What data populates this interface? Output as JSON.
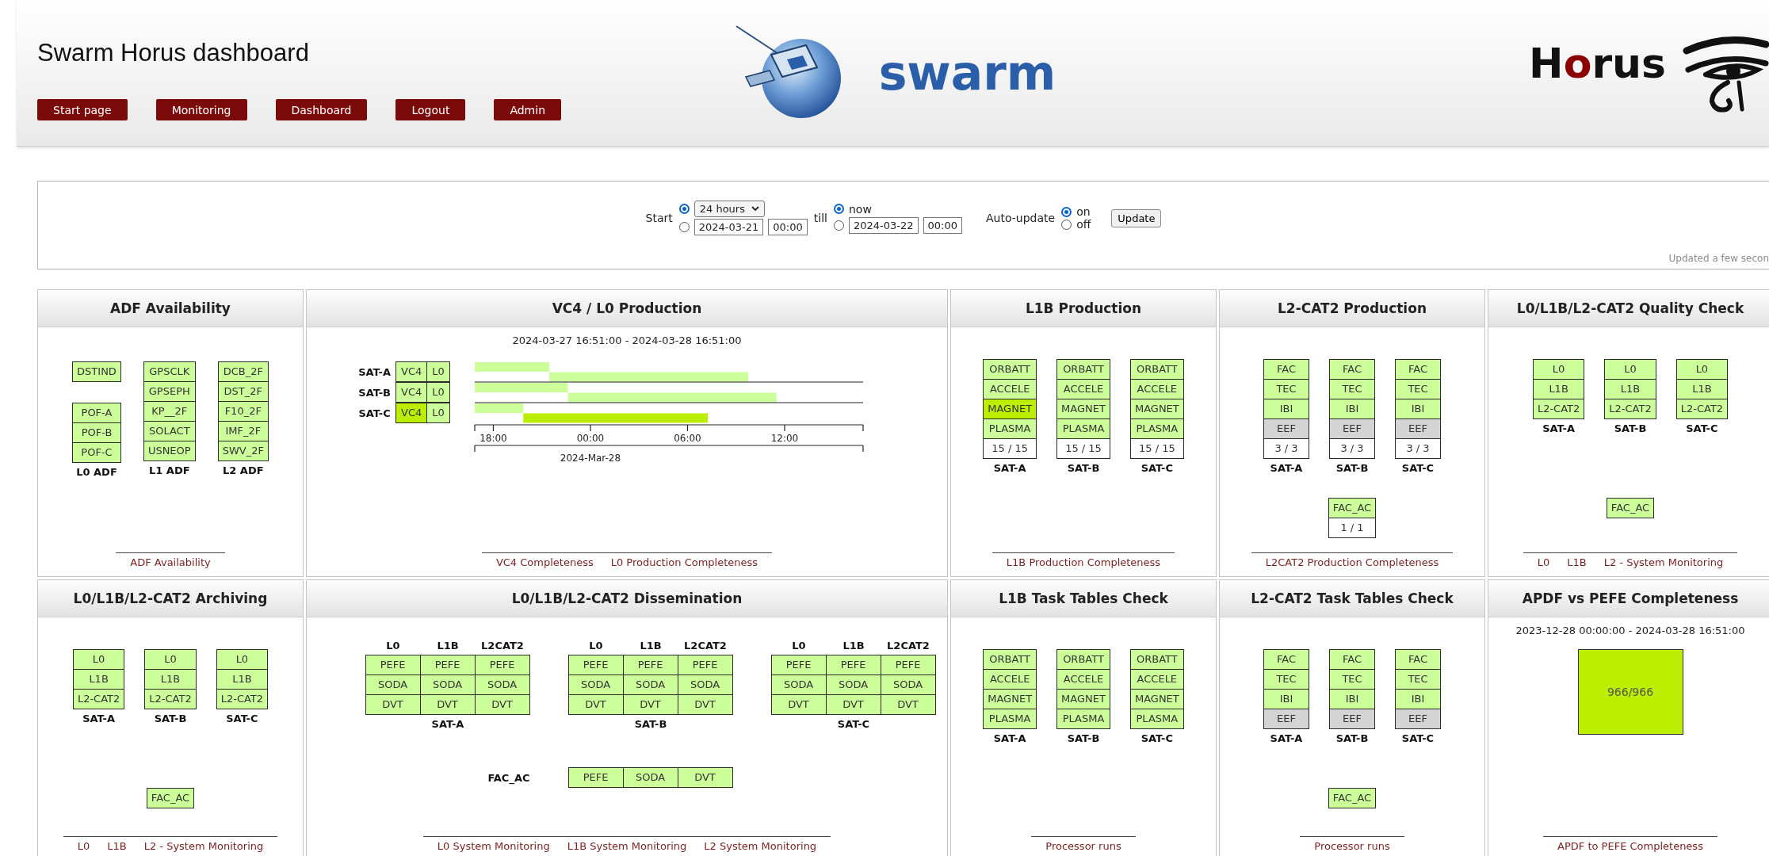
{
  "header": {
    "title": "Swarm Horus dashboard",
    "nav": [
      "Start page",
      "Monitoring",
      "Dashboard",
      "Logout",
      "Admin"
    ],
    "logo_text": "swarm",
    "brand": [
      {
        "text": "H",
        "accent": false
      },
      {
        "text": "o",
        "accent": true
      },
      {
        "text": "rus",
        "accent": false
      }
    ]
  },
  "controls": {
    "start_label": "Start",
    "start_options": [
      {
        "kind": "select",
        "value": "24 hours",
        "selected": true
      },
      {
        "kind": "datetime",
        "date": "2024-03-21",
        "time": "00:00",
        "selected": false
      }
    ],
    "till_label": "till",
    "end_options": [
      {
        "kind": "label",
        "label": "now",
        "selected": true
      },
      {
        "kind": "datetime",
        "date": "2024-03-22",
        "time": "00:00",
        "selected": false
      }
    ],
    "auto_label": "Auto-update",
    "auto_options": [
      {
        "label": "on",
        "selected": true
      },
      {
        "label": "off",
        "selected": false
      }
    ],
    "button": "Update",
    "status": "Updated a few secon"
  },
  "panels": [
    {
      "title": "ADF Availability",
      "kind": "adf",
      "columns": [
        {
          "label": "L0 ADF",
          "groups": [
            [
              {
                "text": "DSTIND",
                "color": "#ccff99"
              }
            ],
            [
              {
                "text": "POF-A",
                "color": "#ccff99"
              },
              {
                "text": "POF-B",
                "color": "#ccff99"
              },
              {
                "text": "POF-C",
                "color": "#ccff99"
              }
            ]
          ]
        },
        {
          "label": "L1 ADF",
          "groups": [
            [
              {
                "text": "GPSCLK",
                "color": "#ccff99"
              },
              {
                "text": "GPSEPH",
                "color": "#ccff99"
              },
              {
                "text": "KP__2F",
                "color": "#ccff99"
              },
              {
                "text": "SOLACT",
                "color": "#ccff99"
              },
              {
                "text": "USNEOP",
                "color": "#ccff99"
              }
            ]
          ]
        },
        {
          "label": "L2 ADF",
          "groups": [
            [
              {
                "text": "DCB_2F",
                "color": "#ccff99"
              },
              {
                "text": "DST_2F",
                "color": "#ccff99"
              },
              {
                "text": "F10_2F",
                "color": "#ccff99"
              },
              {
                "text": "IMF_2F",
                "color": "#ccff99"
              },
              {
                "text": "SWV_2F",
                "color": "#ccff99"
              }
            ]
          ]
        }
      ],
      "footer": [
        "ADF Availability"
      ]
    },
    {
      "title": "VC4 / L0 Production",
      "kind": "gantt",
      "range": "2024-03-27 16:51:00 - 2024-03-28 16:51:00",
      "axis": {
        "ticks": [
          "18:00",
          "00:00",
          "06:00",
          "12:00"
        ],
        "date_label": "2024-Mar-28"
      },
      "rows": [
        {
          "label": "SAT-A",
          "cells": [
            {
              "text": "VC4",
              "color": "#ccff99"
            },
            {
              "text": "L0",
              "color": "#ccff99"
            }
          ],
          "bars": [
            {
              "color": "#ccff99"
            },
            {
              "color": "#ccff99"
            }
          ]
        },
        {
          "label": "SAT-B",
          "cells": [
            {
              "text": "VC4",
              "color": "#ccff99"
            },
            {
              "text": "L0",
              "color": "#ccff99"
            }
          ],
          "bars": [
            {
              "color": "#ccff99"
            },
            {
              "color": "#ccff99"
            }
          ]
        },
        {
          "label": "SAT-C",
          "cells": [
            {
              "text": "VC4",
              "color": "#bbee00"
            },
            {
              "text": "L0",
              "color": "#ccff99"
            }
          ],
          "bars": [
            {
              "color": "#ccff99"
            },
            {
              "color": "#bbee00"
            }
          ]
        }
      ],
      "footer": [
        "VC4 Completeness",
        "L0 Production Completeness"
      ]
    },
    {
      "title": "L1B Production",
      "kind": "stacks",
      "stacks": [
        {
          "label": "SAT-A",
          "cells": [
            {
              "text": "ORBATT",
              "color": "#ccff99"
            },
            {
              "text": "ACCELE",
              "color": "#ccff99"
            },
            {
              "text": "MAGNET",
              "color": "#bbee00"
            },
            {
              "text": "PLASMA",
              "color": "#ccff99"
            },
            {
              "text": "15 / 15",
              "color": "#ffffff"
            }
          ]
        },
        {
          "label": "SAT-B",
          "cells": [
            {
              "text": "ORBATT",
              "color": "#ccff99"
            },
            {
              "text": "ACCELE",
              "color": "#ccff99"
            },
            {
              "text": "MAGNET",
              "color": "#ccff99"
            },
            {
              "text": "PLASMA",
              "color": "#ccff99"
            },
            {
              "text": "15 / 15",
              "color": "#ffffff"
            }
          ]
        },
        {
          "label": "SAT-C",
          "cells": [
            {
              "text": "ORBATT",
              "color": "#ccff99"
            },
            {
              "text": "ACCELE",
              "color": "#ccff99"
            },
            {
              "text": "MAGNET",
              "color": "#ccff99"
            },
            {
              "text": "PLASMA",
              "color": "#ccff99"
            },
            {
              "text": "15 / 15",
              "color": "#ffffff"
            }
          ]
        }
      ],
      "footer": [
        "L1B Production Completeness"
      ]
    },
    {
      "title": "L2-CAT2 Production",
      "kind": "stacks",
      "stacks": [
        {
          "label": "SAT-A",
          "cells": [
            {
              "text": "FAC",
              "color": "#ccff99"
            },
            {
              "text": "TEC",
              "color": "#ccff99"
            },
            {
              "text": "IBI",
              "color": "#ccff99"
            },
            {
              "text": "EEF",
              "color": "#d4d4d4"
            },
            {
              "text": "3 / 3",
              "color": "#ffffff"
            }
          ]
        },
        {
          "label": "SAT-B",
          "cells": [
            {
              "text": "FAC",
              "color": "#ccff99"
            },
            {
              "text": "TEC",
              "color": "#ccff99"
            },
            {
              "text": "IBI",
              "color": "#ccff99"
            },
            {
              "text": "EEF",
              "color": "#d4d4d4"
            },
            {
              "text": "3 / 3",
              "color": "#ffffff"
            }
          ]
        },
        {
          "label": "SAT-C",
          "cells": [
            {
              "text": "FAC",
              "color": "#ccff99"
            },
            {
              "text": "TEC",
              "color": "#ccff99"
            },
            {
              "text": "IBI",
              "color": "#ccff99"
            },
            {
              "text": "EEF",
              "color": "#d4d4d4"
            },
            {
              "text": "3 / 3",
              "color": "#ffffff"
            }
          ]
        }
      ],
      "extra": [
        {
          "text": "FAC_AC",
          "color": "#ccff99"
        },
        {
          "text": "1 / 1",
          "color": "#ffffff"
        }
      ],
      "footer": [
        "L2CAT2 Production Completeness"
      ]
    },
    {
      "title": "L0/L1B/L2-CAT2 Quality Check",
      "kind": "stacks",
      "stacks": [
        {
          "label": "SAT-A",
          "cells": [
            {
              "text": "L0",
              "color": "#ccff99"
            },
            {
              "text": "L1B",
              "color": "#ccff99"
            },
            {
              "text": "L2-CAT2",
              "color": "#ccff99"
            }
          ]
        },
        {
          "label": "SAT-B",
          "cells": [
            {
              "text": "L0",
              "color": "#ccff99"
            },
            {
              "text": "L1B",
              "color": "#ccff99"
            },
            {
              "text": "L2-CAT2",
              "color": "#ccff99"
            }
          ]
        },
        {
          "label": "SAT-C",
          "cells": [
            {
              "text": "L0",
              "color": "#ccff99"
            },
            {
              "text": "L1B",
              "color": "#ccff99"
            },
            {
              "text": "L2-CAT2",
              "color": "#ccff99"
            }
          ]
        }
      ],
      "extra": [
        {
          "text": "FAC_AC",
          "color": "#ccff99"
        }
      ],
      "footer": [
        "L0",
        "L1B",
        "L2 - System Monitoring"
      ]
    },
    {
      "title": "L0/L1B/L2-CAT2 Archiving",
      "kind": "stacks",
      "stacks": [
        {
          "label": "SAT-A",
          "cells": [
            {
              "text": "L0",
              "color": "#ccff99"
            },
            {
              "text": "L1B",
              "color": "#ccff99"
            },
            {
              "text": "L2-CAT2",
              "color": "#ccff99"
            }
          ]
        },
        {
          "label": "SAT-B",
          "cells": [
            {
              "text": "L0",
              "color": "#ccff99"
            },
            {
              "text": "L1B",
              "color": "#ccff99"
            },
            {
              "text": "L2-CAT2",
              "color": "#ccff99"
            }
          ]
        },
        {
          "label": "SAT-C",
          "cells": [
            {
              "text": "L0",
              "color": "#ccff99"
            },
            {
              "text": "L1B",
              "color": "#ccff99"
            },
            {
              "text": "L2-CAT2",
              "color": "#ccff99"
            }
          ]
        }
      ],
      "extra": [
        {
          "text": "FAC_AC",
          "color": "#ccff99"
        }
      ],
      "footer": [
        "L0",
        "L1B",
        "L2 - System Monitoring"
      ]
    },
    {
      "title": "L0/L1B/L2-CAT2 Dissemination",
      "kind": "dissemination",
      "groups": [
        {
          "label": "SAT-A",
          "columns": [
            "L0",
            "L1B",
            "L2CAT2"
          ],
          "rows": [
            [
              {
                "text": "PEFE",
                "color": "#ccff99"
              },
              {
                "text": "PEFE",
                "color": "#ccff99"
              },
              {
                "text": "PEFE",
                "color": "#ccff99"
              }
            ],
            [
              {
                "text": "SODA",
                "color": "#ccff99"
              },
              {
                "text": "SODA",
                "color": "#ccff99"
              },
              {
                "text": "SODA",
                "color": "#ccff99"
              }
            ],
            [
              {
                "text": "DVT",
                "color": "#ccff99"
              },
              {
                "text": "DVT",
                "color": "#ccff99"
              },
              {
                "text": "DVT",
                "color": "#ccff99"
              }
            ]
          ]
        },
        {
          "label": "SAT-B",
          "columns": [
            "L0",
            "L1B",
            "L2CAT2"
          ],
          "rows": [
            [
              {
                "text": "PEFE",
                "color": "#ccff99"
              },
              {
                "text": "PEFE",
                "color": "#ccff99"
              },
              {
                "text": "PEFE",
                "color": "#ccff99"
              }
            ],
            [
              {
                "text": "SODA",
                "color": "#ccff99"
              },
              {
                "text": "SODA",
                "color": "#ccff99"
              },
              {
                "text": "SODA",
                "color": "#ccff99"
              }
            ],
            [
              {
                "text": "DVT",
                "color": "#ccff99"
              },
              {
                "text": "DVT",
                "color": "#ccff99"
              },
              {
                "text": "DVT",
                "color": "#ccff99"
              }
            ]
          ]
        },
        {
          "label": "SAT-C",
          "columns": [
            "L0",
            "L1B",
            "L2CAT2"
          ],
          "rows": [
            [
              {
                "text": "PEFE",
                "color": "#ccff99"
              },
              {
                "text": "PEFE",
                "color": "#ccff99"
              },
              {
                "text": "PEFE",
                "color": "#ccff99"
              }
            ],
            [
              {
                "text": "SODA",
                "color": "#ccff99"
              },
              {
                "text": "SODA",
                "color": "#ccff99"
              },
              {
                "text": "SODA",
                "color": "#ccff99"
              }
            ],
            [
              {
                "text": "DVT",
                "color": "#ccff99"
              },
              {
                "text": "DVT",
                "color": "#ccff99"
              },
              {
                "text": "DVT",
                "color": "#ccff99"
              }
            ]
          ]
        }
      ],
      "extra": {
        "label": "FAC_AC",
        "cells": [
          {
            "text": "PEFE",
            "color": "#ccff99"
          },
          {
            "text": "SODA",
            "color": "#ccff99"
          },
          {
            "text": "DVT",
            "color": "#ccff99"
          }
        ]
      },
      "footer": [
        "L0 System Monitoring",
        "L1B System Monitoring",
        "L2 System Monitoring"
      ]
    },
    {
      "title": "L1B Task Tables Check",
      "kind": "stacks",
      "stacks": [
        {
          "label": "SAT-A",
          "cells": [
            {
              "text": "ORBATT",
              "color": "#ccff99"
            },
            {
              "text": "ACCELE",
              "color": "#ccff99"
            },
            {
              "text": "MAGNET",
              "color": "#ccff99"
            },
            {
              "text": "PLASMA",
              "color": "#ccff99"
            }
          ]
        },
        {
          "label": "SAT-B",
          "cells": [
            {
              "text": "ORBATT",
              "color": "#ccff99"
            },
            {
              "text": "ACCELE",
              "color": "#ccff99"
            },
            {
              "text": "MAGNET",
              "color": "#ccff99"
            },
            {
              "text": "PLASMA",
              "color": "#ccff99"
            }
          ]
        },
        {
          "label": "SAT-C",
          "cells": [
            {
              "text": "ORBATT",
              "color": "#ccff99"
            },
            {
              "text": "ACCELE",
              "color": "#ccff99"
            },
            {
              "text": "MAGNET",
              "color": "#ccff99"
            },
            {
              "text": "PLASMA",
              "color": "#ccff99"
            }
          ]
        }
      ],
      "footer": [
        "Processor runs"
      ]
    },
    {
      "title": "L2-CAT2 Task Tables Check",
      "kind": "stacks",
      "stacks": [
        {
          "label": "SAT-A",
          "cells": [
            {
              "text": "FAC",
              "color": "#ccff99"
            },
            {
              "text": "TEC",
              "color": "#ccff99"
            },
            {
              "text": "IBI",
              "color": "#ccff99"
            },
            {
              "text": "EEF",
              "color": "#d4d4d4"
            }
          ]
        },
        {
          "label": "SAT-B",
          "cells": [
            {
              "text": "FAC",
              "color": "#ccff99"
            },
            {
              "text": "TEC",
              "color": "#ccff99"
            },
            {
              "text": "IBI",
              "color": "#ccff99"
            },
            {
              "text": "EEF",
              "color": "#d4d4d4"
            }
          ]
        },
        {
          "label": "SAT-C",
          "cells": [
            {
              "text": "FAC",
              "color": "#ccff99"
            },
            {
              "text": "TEC",
              "color": "#ccff99"
            },
            {
              "text": "IBI",
              "color": "#ccff99"
            },
            {
              "text": "EEF",
              "color": "#d4d4d4"
            }
          ]
        }
      ],
      "extra": [
        {
          "text": "FAC_AC",
          "color": "#ccff99"
        }
      ],
      "footer": [
        "Processor runs"
      ]
    },
    {
      "title": "APDF vs PEFE Completeness",
      "kind": "completeness",
      "range": "2023-12-28 00:00:00 - 2024-03-28 16:51:00",
      "cell": {
        "text": "966/966",
        "color": "#bbee00"
      },
      "footer": [
        "APDF to PEFE Completeness"
      ]
    }
  ]
}
